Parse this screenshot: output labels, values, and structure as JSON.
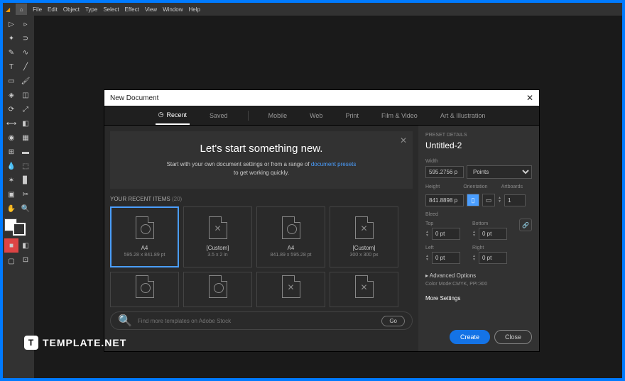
{
  "menu": {
    "items": [
      "File",
      "Edit",
      "Object",
      "Type",
      "Select",
      "Effect",
      "View",
      "Window",
      "Help"
    ]
  },
  "dialog": {
    "title": "New Document",
    "tabs": [
      {
        "label": "Recent",
        "icon": "clock"
      },
      {
        "label": "Saved"
      },
      {
        "label": "Mobile"
      },
      {
        "label": "Web"
      },
      {
        "label": "Print"
      },
      {
        "label": "Film & Video"
      },
      {
        "label": "Art & Illustration"
      }
    ],
    "hero": {
      "title": "Let's start something new.",
      "line1": "Start with your own document settings or from a range of ",
      "link": "document presets",
      "line2": "to get working quickly."
    },
    "recent": {
      "label": "YOUR RECENT ITEMS",
      "count": "(20)"
    },
    "presets": [
      {
        "name": "A4",
        "dim": "595.28 x 841.89 pt",
        "icon": "fold"
      },
      {
        "name": "[Custom]",
        "dim": "3.5 x 2 in",
        "icon": "cross"
      },
      {
        "name": "A4",
        "dim": "841.89 x 595.28 pt",
        "icon": "fold"
      },
      {
        "name": "[Custom]",
        "dim": "300 x 300 px",
        "icon": "cross"
      }
    ],
    "search": {
      "placeholder": "Find more templates on Adobe Stock",
      "go": "Go"
    }
  },
  "details": {
    "heading": "PRESET DETAILS",
    "name": "Untitled-2",
    "width_label": "Width",
    "width": "595.2756 p",
    "units": "Points",
    "height_label": "Height",
    "height": "841.8898 p",
    "orientation_label": "Orientation",
    "artboards_label": "Artboards",
    "artboards": "1",
    "bleed_label": "Bleed",
    "bleed": {
      "top_label": "Top",
      "top": "0 pt",
      "bottom_label": "Bottom",
      "bottom": "0 pt",
      "left_label": "Left",
      "left": "0 pt",
      "right_label": "Right",
      "right": "0 pt"
    },
    "advanced": "Advanced Options",
    "mode": "Color Mode:CMYK, PPI:300",
    "more": "More Settings",
    "create": "Create",
    "close": "Close"
  },
  "watermark": {
    "text": "TEMPLATE.NET"
  }
}
